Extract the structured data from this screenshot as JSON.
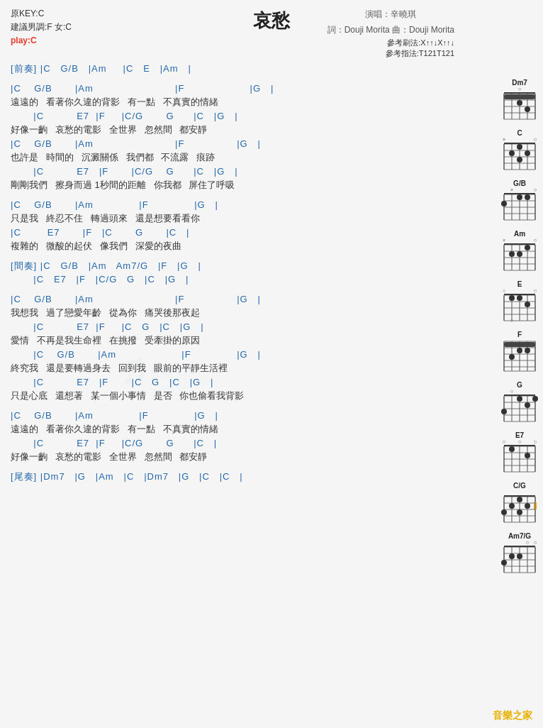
{
  "header": {
    "title": "哀愁",
    "original_key": "原KEY:C",
    "suggested_key": "建議男調:F 女:C",
    "play_key": "play:C",
    "performer": "演唱：辛曉琪",
    "lyricist": "詞：Douji Morita  曲：Douji Morita"
  },
  "strumming": {
    "method": "參考刷法:X↑↑↓X↑↑↓",
    "fingering": "參考指法:T121T121"
  },
  "sections": {
    "prelude": {
      "chords": "[前奏] |C   G/B   |Am     |C   E   |Am   |"
    },
    "verse1": {
      "chord1": "|C    G/B       |Am                         |F                    |G   |",
      "lyric1": "遠遠的   看著你久違的背影   有一點   不真實的情緒",
      "chord2": "       |C          E7  |F     |C/G       G      |C   |G   |",
      "lyric2": "好像一齣   哀愁的電影   全世界   忽然間   都安靜",
      "chord3": "|C    G/B       |Am                         |F                |G   |",
      "lyric3": "也許是   時間的   沉澱關係   我們都   不流露   痕跡",
      "chord4": "       |C          E7   |F       |C/G    G      |C   |G   |",
      "lyric4": "剛剛我們   擦身而過 1秒間的距離   你我都   屏住了呼吸"
    },
    "chorus1": {
      "chord1": "|C    G/B       |Am              |F              |G   |",
      "lyric1": "只是我   終忍不住   轉過頭來   還是想要看看你",
      "chord2": "|C        E7       |F   |C       G       |C   |",
      "lyric2": "複雜的   微酸的起伏   像我們   深愛的夜曲"
    },
    "interlude": {
      "chord1": "[間奏] |C   G/B   |Am   Am7/G   |F   |G   |",
      "chord2": "       |C   E7   |F   |C/G   G   |C   |G   |"
    },
    "verse2": {
      "chord1": "|C    G/B       |Am                         |F                |G   |",
      "lyric1": "我想我   過了戀愛年齡   從為你   痛哭後那夜起",
      "chord2": "       |C          E7  |F     |C   G   |C   |G   |",
      "lyric2": "愛情   不再是我生命裡   在挑撥   受牽掛的原因",
      "chord3": "       |C    G/B       |Am                    |F              |G   |",
      "lyric3": "終究我   還是要轉過身去   回到我   眼前的平靜生活裡",
      "chord4": "       |C          E7   |F       |C   G   |C   |G   |",
      "lyric4": "只是心底   還想著   某一個小事情   是否   你也偷看我背影"
    },
    "chorus2": {
      "chord1": "|C    G/B       |Am              |F              |G   |",
      "lyric1": "遠遠的   看著你久違的背影   有一點   不真實的情緒",
      "chord2": "       |C          E7  |F     |C/G       G      |C   |",
      "lyric2": "好像一齣   哀愁的電影   全世界   忽然間   都安靜",
      "chord3": "",
      "lyric3": "",
      "chord4": "",
      "lyric4": ""
    },
    "verse3": {
      "chord1": "",
      "lyric1": "",
      "chord2": "",
      "lyric2": ""
    },
    "outro": {
      "chords": "[尾奏] |Dm7   |G   |Am   |C   |Dm7   |G   |C   |C   |"
    }
  },
  "footer": {
    "logo": "音樂之家"
  }
}
